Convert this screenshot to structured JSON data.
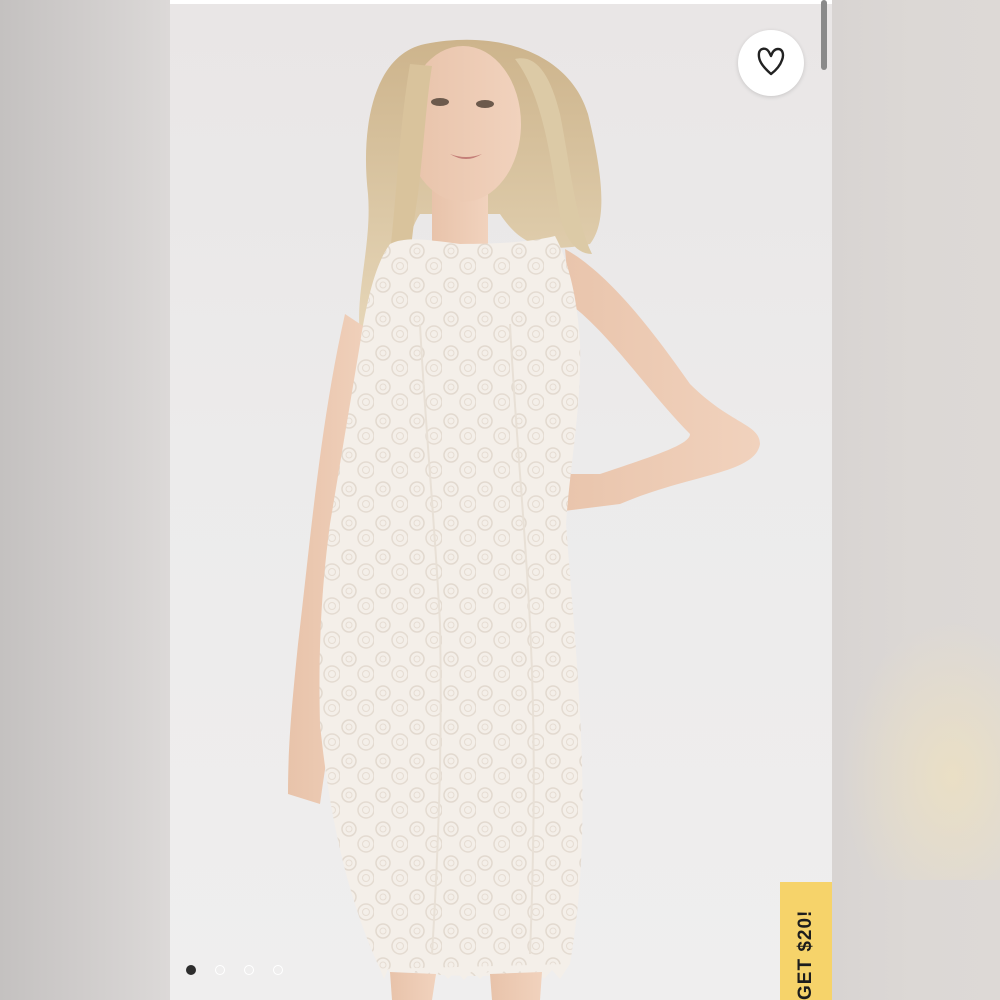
{
  "listing": {
    "favorite_icon": "heart-outline-icon",
    "image_dots": [
      {
        "state": "active"
      },
      {
        "state": "inactive"
      },
      {
        "state": "inactive"
      },
      {
        "state": "inactive"
      }
    ],
    "promo_tab_label": "GET $20!",
    "colors": {
      "promo": "#f6d36a",
      "dot_active": "#2d2d2d",
      "background": "#ececeb"
    }
  }
}
